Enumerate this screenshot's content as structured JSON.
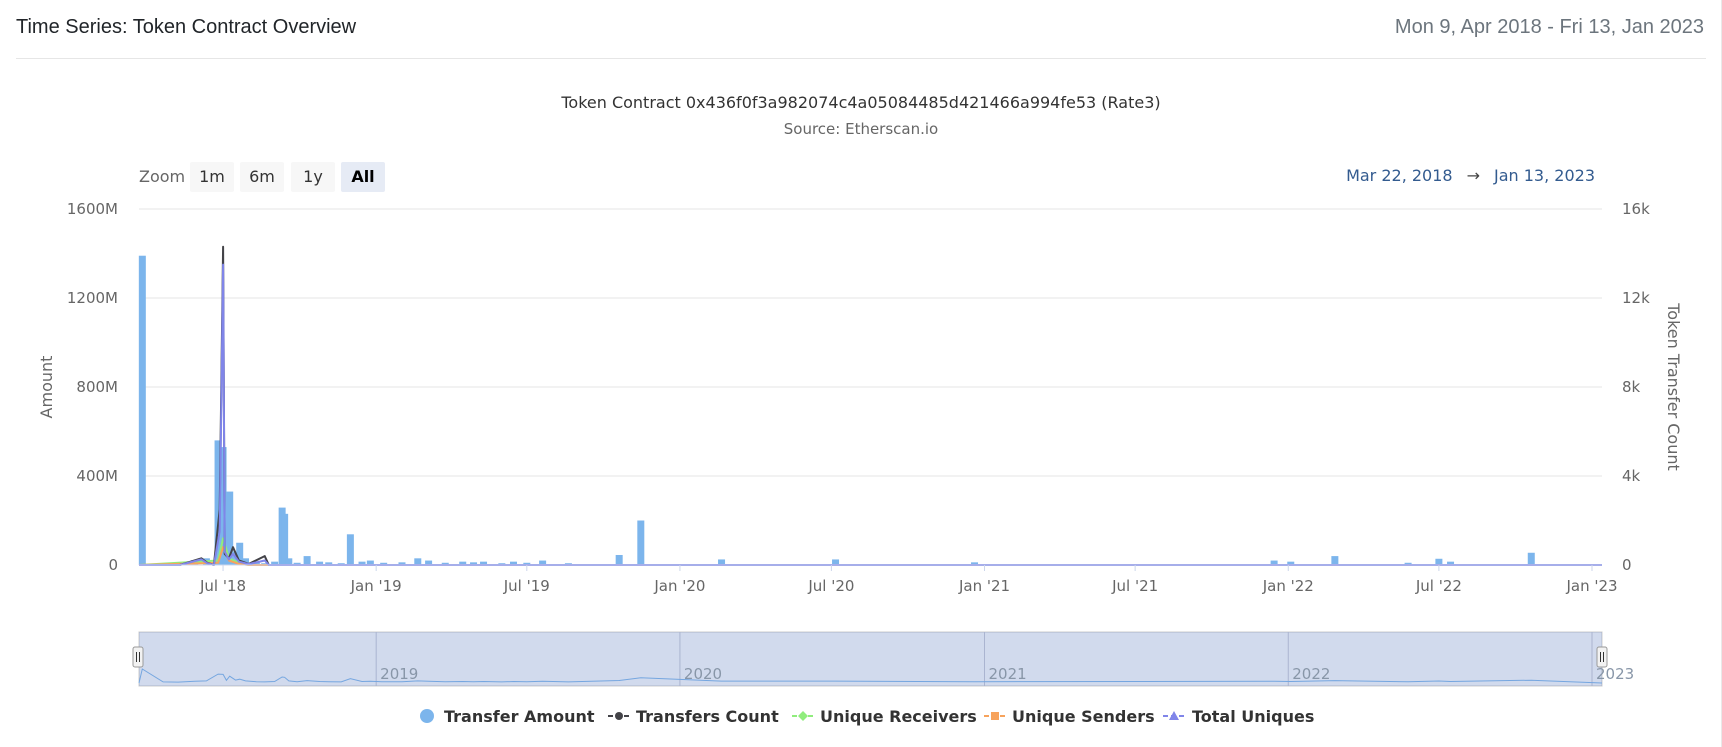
{
  "header": {
    "title": "Time Series: Token Contract Overview",
    "date_range": "Mon 9, Apr 2018 - Fri 13, Jan 2023"
  },
  "range_selector": {
    "zoom_label": "Zoom",
    "buttons": [
      {
        "label": "1m",
        "selected": false
      },
      {
        "label": "6m",
        "selected": false
      },
      {
        "label": "1y",
        "selected": false
      },
      {
        "label": "All",
        "selected": true
      }
    ],
    "from": "Mar 22, 2018",
    "arrow": "→",
    "to": "Jan 13, 2023"
  },
  "navigator": {
    "year_labels": [
      "2019",
      "2020",
      "2021",
      "2022",
      "2023"
    ]
  },
  "chart_data": {
    "type": "bar",
    "title": "Token Contract 0x436f0f3a982074c4a05084485d421466a994fe53 (Rate3)",
    "subtitle": "Source: Etherscan.io",
    "xlabel": "",
    "ylabel": "Amount",
    "y2label": "Token Transfer Count",
    "x_range": [
      "2018-03-22",
      "2023-01-13"
    ],
    "x_ticks": [
      {
        "date": "2018-07-01",
        "label": "Jul '18"
      },
      {
        "date": "2019-01-01",
        "label": "Jan '19"
      },
      {
        "date": "2019-07-01",
        "label": "Jul '19"
      },
      {
        "date": "2020-01-01",
        "label": "Jan '20"
      },
      {
        "date": "2020-07-01",
        "label": "Jul '20"
      },
      {
        "date": "2021-01-01",
        "label": "Jan '21"
      },
      {
        "date": "2021-07-01",
        "label": "Jul '21"
      },
      {
        "date": "2022-01-01",
        "label": "Jan '22"
      },
      {
        "date": "2022-07-01",
        "label": "Jul '22"
      },
      {
        "date": "2023-01-01",
        "label": "Jan '23"
      }
    ],
    "y_ticks": [
      {
        "value": 0,
        "label": "0"
      },
      {
        "value": 400000000,
        "label": "400M"
      },
      {
        "value": 800000000,
        "label": "800M"
      },
      {
        "value": 1200000000,
        "label": "1200M"
      },
      {
        "value": 1600000000,
        "label": "1600M"
      }
    ],
    "y2_ticks": [
      {
        "value": 0,
        "label": "0"
      },
      {
        "value": 4000,
        "label": "4k"
      },
      {
        "value": 8000,
        "label": "8k"
      },
      {
        "value": 12000,
        "label": "12k"
      },
      {
        "value": 16000,
        "label": "16k"
      }
    ],
    "ylim": [
      0,
      1600000000
    ],
    "y2lim": [
      0,
      16000
    ],
    "grid": true,
    "legend_position": "bottom",
    "colors": {
      "transfer_amount": "#7cb5ec",
      "transfers_count": "#434348",
      "unique_receivers": "#90ed7d",
      "unique_senders": "#f7a35c",
      "total_uniques": "#8085e9"
    },
    "series": [
      {
        "name": "Transfer Amount",
        "type": "column",
        "axis": "left",
        "data": [
          [
            "2018-03-26",
            1390000000
          ],
          [
            "2018-04-20",
            8000000
          ],
          [
            "2018-05-08",
            6000000
          ],
          [
            "2018-05-28",
            22000000
          ],
          [
            "2018-06-11",
            30000000
          ],
          [
            "2018-06-25",
            560000000
          ],
          [
            "2018-07-01",
            530000000
          ],
          [
            "2018-07-05",
            50000000
          ],
          [
            "2018-07-09",
            330000000
          ],
          [
            "2018-07-16",
            60000000
          ],
          [
            "2018-07-21",
            100000000
          ],
          [
            "2018-07-28",
            30000000
          ],
          [
            "2018-08-10",
            12000000
          ],
          [
            "2018-08-20",
            8000000
          ],
          [
            "2018-09-01",
            15000000
          ],
          [
            "2018-09-10",
            258000000
          ],
          [
            "2018-09-13",
            230000000
          ],
          [
            "2018-09-18",
            30000000
          ],
          [
            "2018-09-28",
            10000000
          ],
          [
            "2018-10-10",
            40000000
          ],
          [
            "2018-10-25",
            15000000
          ],
          [
            "2018-11-05",
            12000000
          ],
          [
            "2018-11-20",
            8000000
          ],
          [
            "2018-12-01",
            138000000
          ],
          [
            "2018-12-15",
            15000000
          ],
          [
            "2018-12-25",
            20000000
          ],
          [
            "2019-01-10",
            10000000
          ],
          [
            "2019-02-01",
            12000000
          ],
          [
            "2019-02-20",
            30000000
          ],
          [
            "2019-03-05",
            20000000
          ],
          [
            "2019-03-25",
            10000000
          ],
          [
            "2019-04-15",
            15000000
          ],
          [
            "2019-04-28",
            12000000
          ],
          [
            "2019-05-10",
            15000000
          ],
          [
            "2019-06-01",
            8000000
          ],
          [
            "2019-06-15",
            15000000
          ],
          [
            "2019-07-01",
            10000000
          ],
          [
            "2019-07-20",
            20000000
          ],
          [
            "2019-08-20",
            8000000
          ],
          [
            "2019-10-20",
            45000000
          ],
          [
            "2019-11-15",
            200000000
          ],
          [
            "2020-02-20",
            25000000
          ],
          [
            "2020-07-06",
            25000000
          ],
          [
            "2020-12-20",
            12000000
          ],
          [
            "2021-12-15",
            20000000
          ],
          [
            "2022-01-04",
            15000000
          ],
          [
            "2022-02-26",
            40000000
          ],
          [
            "2022-05-25",
            10000000
          ],
          [
            "2022-07-01",
            28000000
          ],
          [
            "2022-07-15",
            15000000
          ],
          [
            "2022-10-20",
            55000000
          ]
        ]
      },
      {
        "name": "Transfers Count",
        "type": "line",
        "axis": "right",
        "data": [
          [
            "2018-03-22",
            0
          ],
          [
            "2018-05-10",
            0
          ],
          [
            "2018-06-05",
            300
          ],
          [
            "2018-06-12",
            100
          ],
          [
            "2018-06-20",
            0
          ],
          [
            "2018-06-27",
            2500
          ],
          [
            "2018-07-01",
            14300
          ],
          [
            "2018-07-03",
            500
          ],
          [
            "2018-07-08",
            300
          ],
          [
            "2018-07-13",
            800
          ],
          [
            "2018-07-20",
            200
          ],
          [
            "2018-08-01",
            50
          ],
          [
            "2018-08-20",
            400
          ],
          [
            "2018-08-25",
            0
          ],
          [
            "2018-12-01",
            0
          ],
          [
            "2023-01-13",
            0
          ]
        ]
      },
      {
        "name": "Unique Receivers",
        "type": "line",
        "axis": "right",
        "data": [
          [
            "2018-03-22",
            0
          ],
          [
            "2018-06-25",
            200
          ],
          [
            "2018-07-01",
            1200
          ],
          [
            "2018-07-08",
            300
          ],
          [
            "2018-07-20",
            100
          ],
          [
            "2018-08-01",
            0
          ],
          [
            "2023-01-13",
            0
          ]
        ]
      },
      {
        "name": "Unique Senders",
        "type": "line",
        "axis": "right",
        "data": [
          [
            "2018-03-22",
            0
          ],
          [
            "2018-06-25",
            100
          ],
          [
            "2018-07-01",
            800
          ],
          [
            "2018-07-08",
            200
          ],
          [
            "2018-07-20",
            50
          ],
          [
            "2018-08-01",
            0
          ],
          [
            "2023-01-13",
            0
          ]
        ]
      },
      {
        "name": "Total Uniques",
        "type": "line",
        "axis": "right",
        "data": [
          [
            "2018-03-22",
            0
          ],
          [
            "2018-05-10",
            0
          ],
          [
            "2018-06-05",
            250
          ],
          [
            "2018-06-12",
            80
          ],
          [
            "2018-06-20",
            0
          ],
          [
            "2018-06-27",
            1500
          ],
          [
            "2018-07-01",
            13500
          ],
          [
            "2018-07-03",
            600
          ],
          [
            "2018-07-08",
            250
          ],
          [
            "2018-07-13",
            500
          ],
          [
            "2018-07-20",
            150
          ],
          [
            "2018-08-01",
            40
          ],
          [
            "2018-08-20",
            200
          ],
          [
            "2018-08-25",
            0
          ],
          [
            "2023-01-13",
            0
          ]
        ]
      }
    ]
  }
}
